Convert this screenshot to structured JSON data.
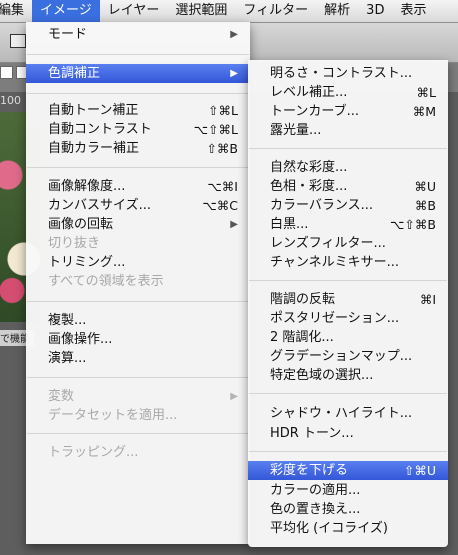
{
  "menubar": {
    "items": [
      "編集",
      "イメージ",
      "レイヤー",
      "選択範囲",
      "フィルター",
      "解析",
      "3D",
      "表示"
    ],
    "active_index": 1
  },
  "background": {
    "zoom": "100",
    "panel_label": "で機能"
  },
  "image_menu": {
    "mode": "モード",
    "adjustments": "色調補正",
    "auto_tone": {
      "label": "自動トーン補正",
      "shortcut": "⇧⌘L"
    },
    "auto_contrast": {
      "label": "自動コントラスト",
      "shortcut": "⌥⇧⌘L"
    },
    "auto_color": {
      "label": "自動カラー補正",
      "shortcut": "⇧⌘B"
    },
    "image_size": {
      "label": "画像解像度...",
      "shortcut": "⌥⌘I"
    },
    "canvas_size": {
      "label": "カンバスサイズ...",
      "shortcut": "⌥⌘C"
    },
    "image_rotation": "画像の回転",
    "crop": "切り抜き",
    "trim": "トリミング...",
    "reveal_all": "すべての領域を表示",
    "duplicate": "複製...",
    "apply_image": "画像操作...",
    "calculations": "演算...",
    "variables": "変数",
    "apply_data_set": "データセットを適用...",
    "trap": "トラッピング..."
  },
  "adjustments_menu": {
    "brightness_contrast": "明るさ・コントラスト...",
    "levels": {
      "label": "レベル補正...",
      "shortcut": "⌘L"
    },
    "curves": {
      "label": "トーンカーブ...",
      "shortcut": "⌘M"
    },
    "exposure": "露光量...",
    "vibrance": "自然な彩度...",
    "hue_saturation": {
      "label": "色相・彩度...",
      "shortcut": "⌘U"
    },
    "color_balance": {
      "label": "カラーバランス...",
      "shortcut": "⌘B"
    },
    "black_white": {
      "label": "白黒...",
      "shortcut": "⌥⇧⌘B"
    },
    "photo_filter": "レンズフィルター...",
    "channel_mixer": "チャンネルミキサー...",
    "invert": {
      "label": "階調の反転",
      "shortcut": "⌘I"
    },
    "posterize": "ポスタリゼーション...",
    "threshold": "2 階調化...",
    "gradient_map": "グラデーションマップ...",
    "selective_color": "特定色域の選択...",
    "shadows_highlights": "シャドウ・ハイライト...",
    "hdr_toning": "HDR トーン...",
    "desaturate": {
      "label": "彩度を下げる",
      "shortcut": "⇧⌘U"
    },
    "match_color": "カラーの適用...",
    "replace_color": "色の置き換え...",
    "equalize": "平均化 (イコライズ)"
  }
}
